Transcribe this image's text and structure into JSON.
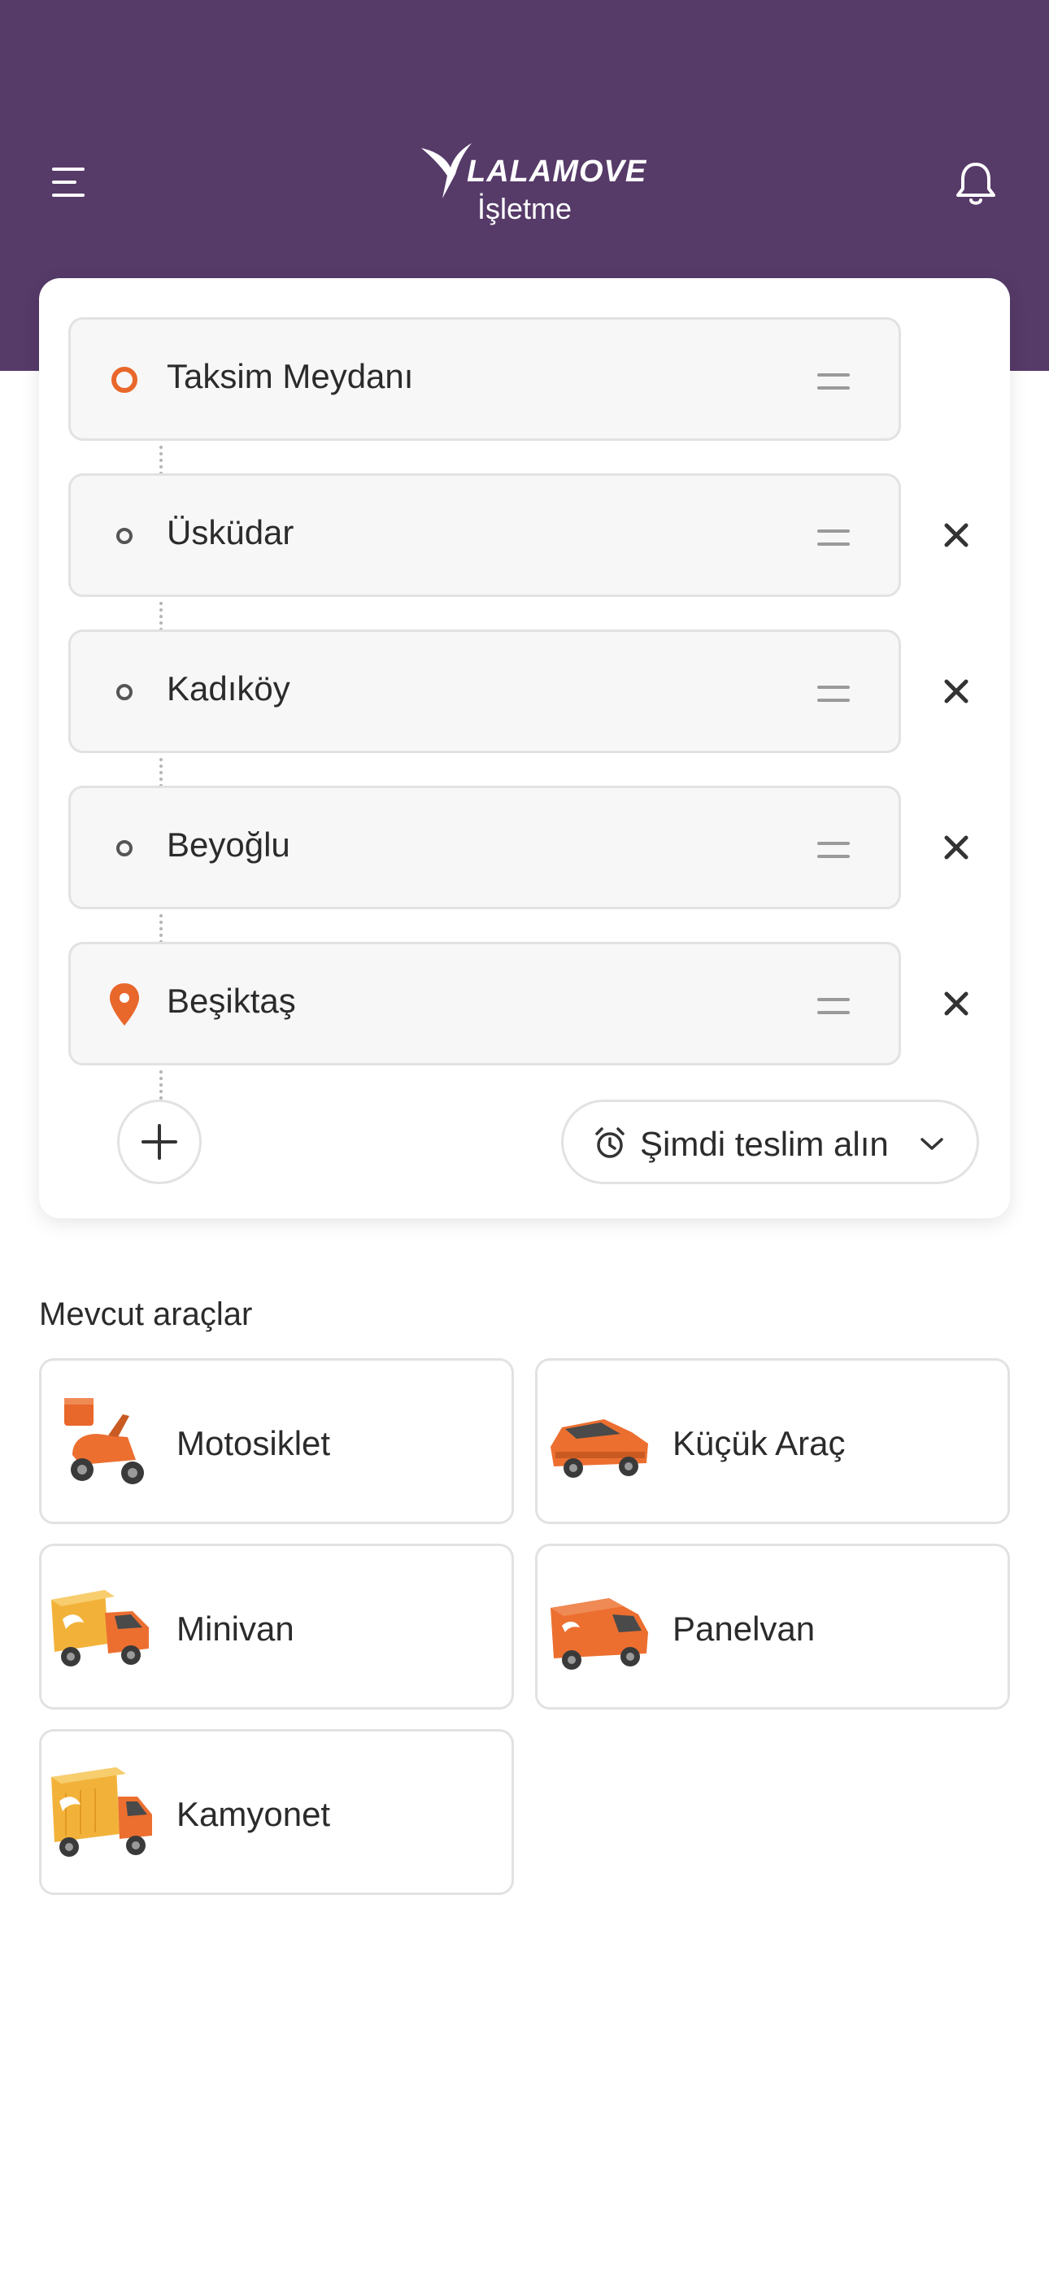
{
  "header": {
    "brand": "LALAMOVE",
    "subtitle": "İşletme",
    "background_color": "#563a68"
  },
  "route": {
    "stops": [
      {
        "label": "Taksim Meydanı",
        "type": "origin",
        "removable": false
      },
      {
        "label": "Üsküdar",
        "type": "waypoint",
        "removable": true
      },
      {
        "label": "Kadıköy",
        "type": "waypoint",
        "removable": true
      },
      {
        "label": "Beyoğlu",
        "type": "waypoint",
        "removable": true
      },
      {
        "label": "Beşiktaş",
        "type": "destination",
        "removable": true
      }
    ],
    "time_selector": "Şimdi teslim alın",
    "accent_color": "#e8672a"
  },
  "vehicles": {
    "title": "Mevcut araçlar",
    "items": [
      {
        "label": "Motosiklet",
        "icon": "motorcycle-icon"
      },
      {
        "label": "Küçük Araç",
        "icon": "small-car-icon"
      },
      {
        "label": "Minivan",
        "icon": "minivan-icon"
      },
      {
        "label": "Panelvan",
        "icon": "panel-van-icon"
      },
      {
        "label": "Kamyonet",
        "icon": "truck-icon"
      }
    ]
  }
}
